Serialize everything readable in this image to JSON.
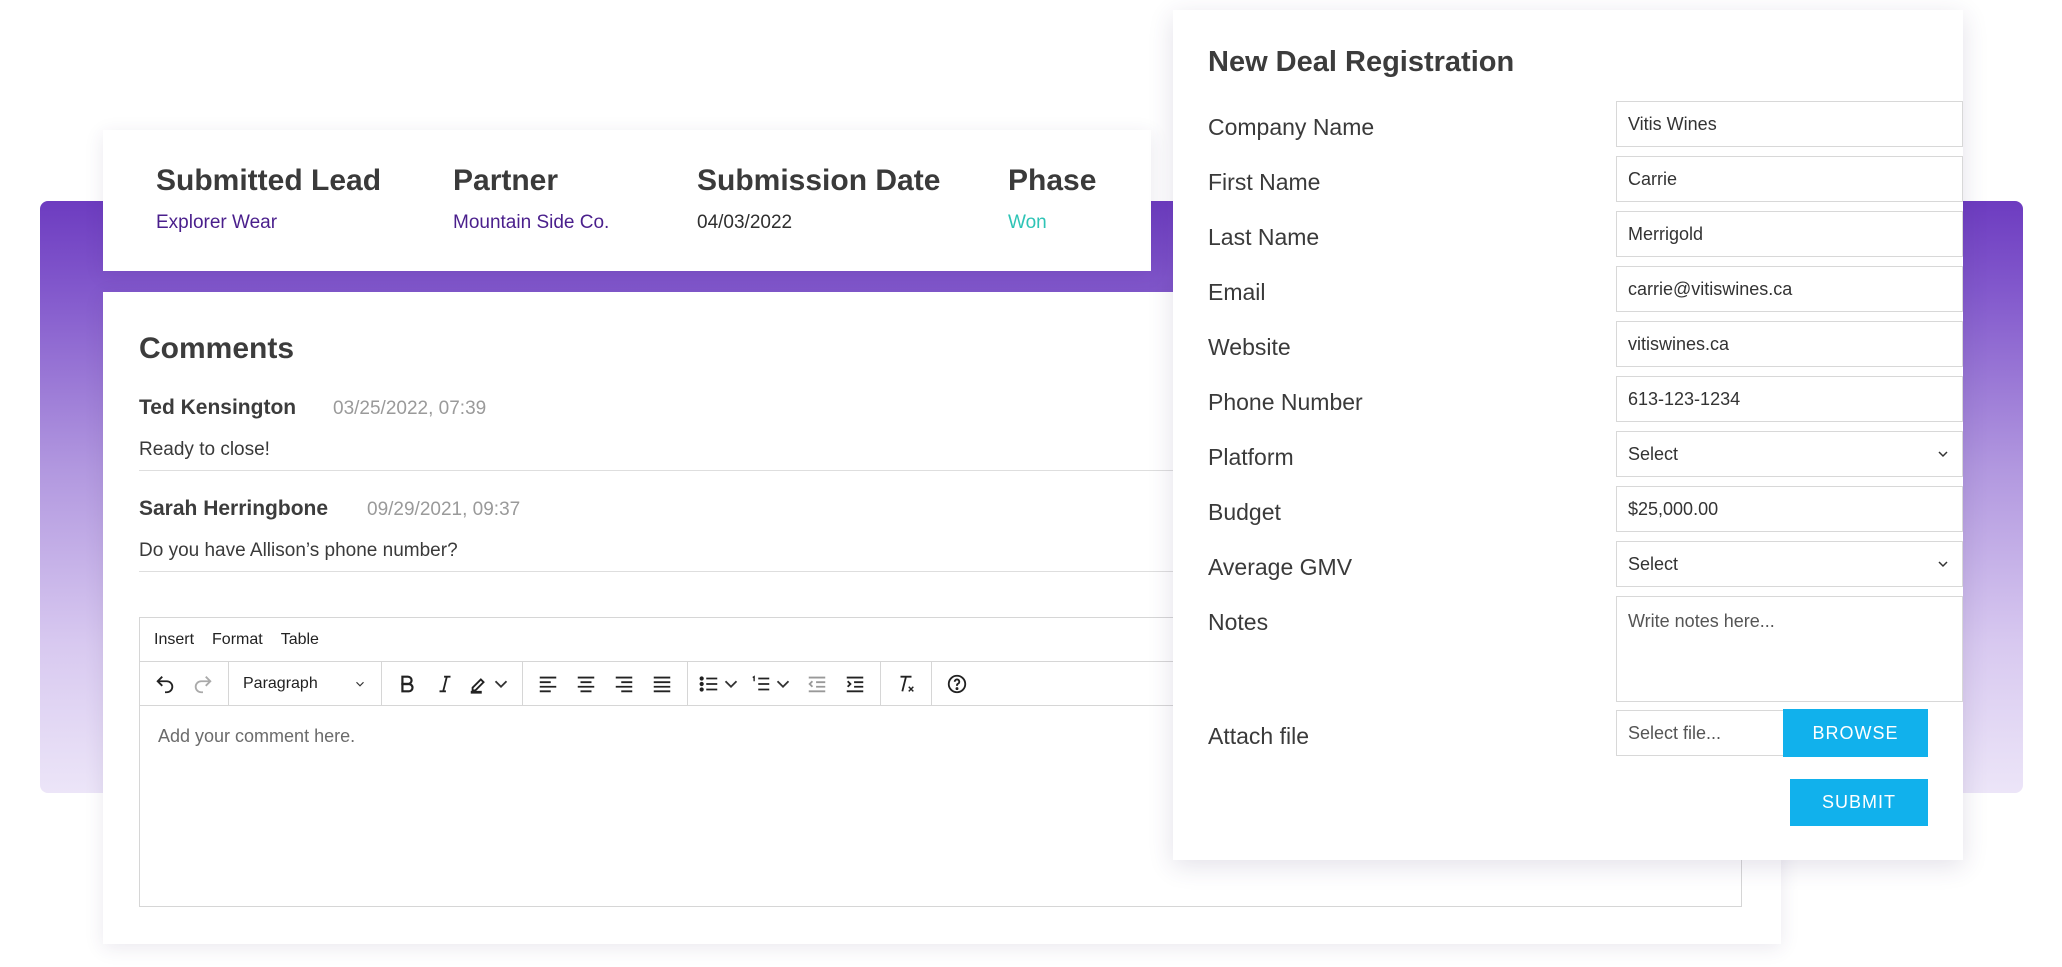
{
  "lead": {
    "columns": [
      {
        "label": "Submitted Lead",
        "value": "Explorer Wear"
      },
      {
        "label": "Partner",
        "value": "Mountain Side Co."
      },
      {
        "label": "Submission Date",
        "value": "04/03/2022"
      },
      {
        "label": "Phase",
        "value": "Won"
      }
    ]
  },
  "comments": {
    "title": "Comments",
    "items": [
      {
        "author": "Ted Kensington",
        "time": "03/25/2022, 07:39",
        "body": "Ready to close!"
      },
      {
        "author": "Sarah Herringbone",
        "time": "09/29/2021, 09:37",
        "body": "Do you have Allison’s phone number?"
      }
    ]
  },
  "editor": {
    "menu": [
      "Insert",
      "Format",
      "Table"
    ],
    "block_format": "Paragraph",
    "placeholder": "Add your comment here."
  },
  "form": {
    "title": "New Deal Registration",
    "fields": [
      {
        "label": "Company Name",
        "value": "Vitis Wines"
      },
      {
        "label": "First Name",
        "value": "Carrie"
      },
      {
        "label": "Last Name",
        "value": "Merrigold"
      },
      {
        "label": "Email",
        "value": "carrie@vitiswines.ca"
      },
      {
        "label": "Website",
        "value": "vitiswines.ca"
      },
      {
        "label": "Phone Number",
        "value": "613-123-1234"
      },
      {
        "label": "Platform",
        "value": "Select"
      },
      {
        "label": "Budget",
        "value": "$25,000.00"
      },
      {
        "label": "Average GMV",
        "value": "Select"
      },
      {
        "label": "Notes",
        "value": "Write notes here..."
      }
    ],
    "attach_label": "Attach file",
    "file_placeholder": "Select file...",
    "browse_label": "BROWSE",
    "submit_label": "SUBMIT"
  },
  "colors": {
    "accent": "#11b1ec",
    "partner_text": "#4a1f8c",
    "phase_won": "#2ec4b6",
    "band_top": "#6d3cc0",
    "band_bottom": "#ece5f8"
  }
}
